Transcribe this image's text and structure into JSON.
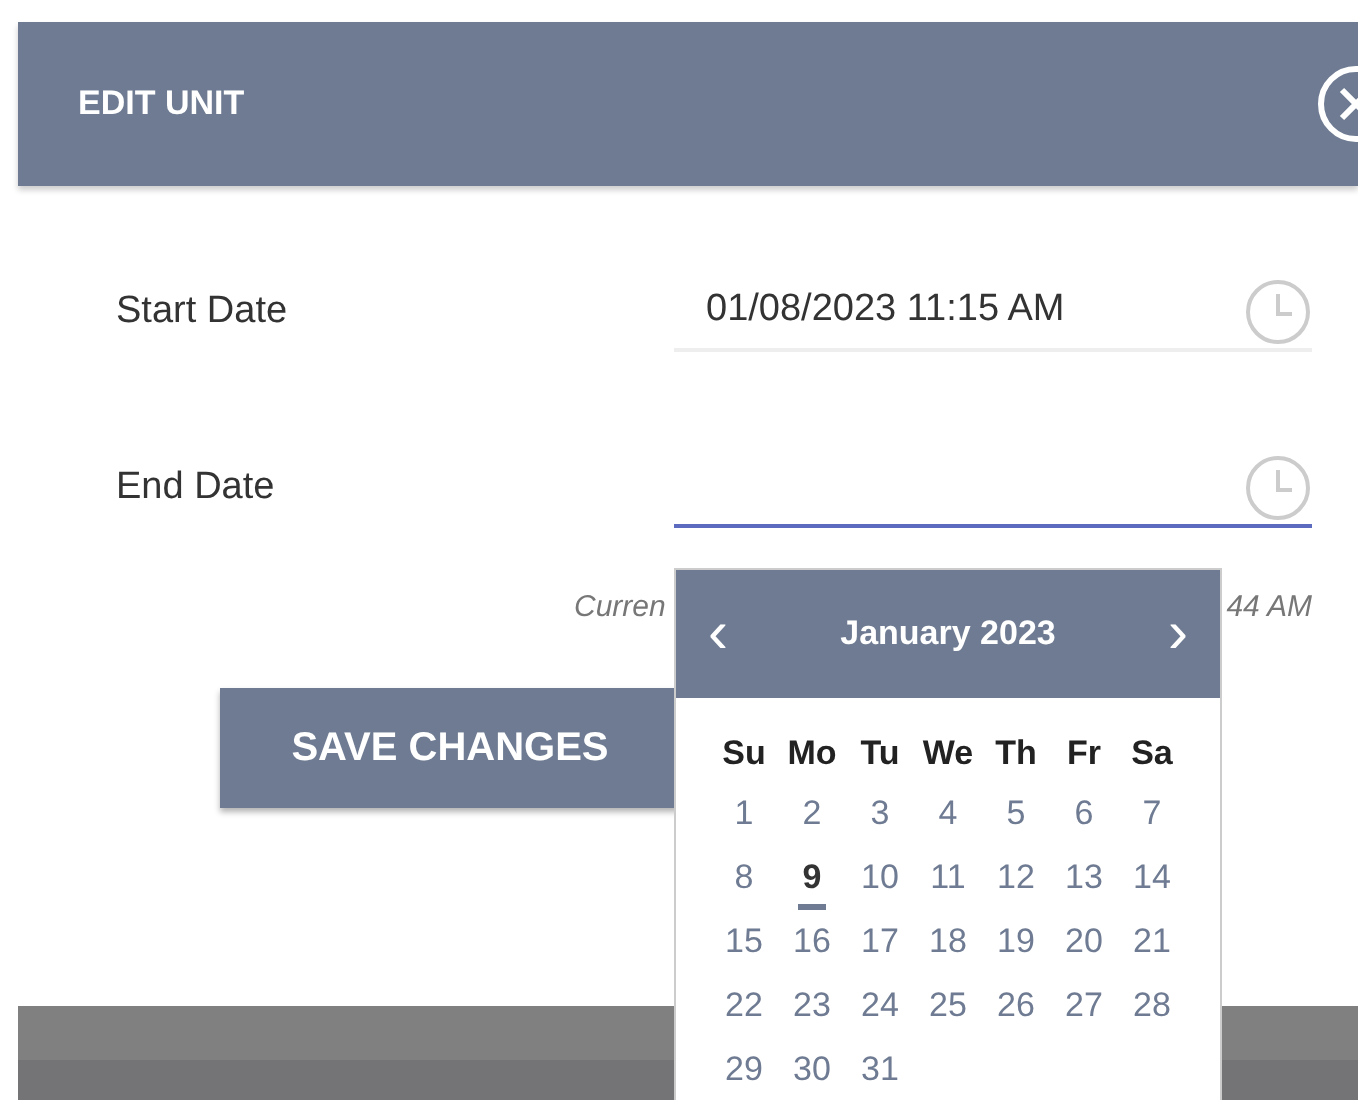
{
  "dialog": {
    "title": "EDIT UNIT"
  },
  "fields": [
    {
      "label": "Start Date",
      "value": "01/08/2023 11:15 AM",
      "focused": false
    },
    {
      "label": "End Date",
      "focused": true
    }
  ],
  "helper_text": {
    "left_part": "Curren",
    "right_part": "44 AM"
  },
  "save_button": "SAVE CHANGES",
  "calendar": {
    "month": "January 2023",
    "prev": "‹",
    "next": "›",
    "weekdays": [
      "Su",
      "Mo",
      "Tu",
      "We",
      "Th",
      "Fr",
      "Sa"
    ],
    "weeks": [
      [
        {
          "day": "1",
          "today": false
        },
        {
          "day": "2",
          "today": false
        },
        {
          "day": "3",
          "today": false
        },
        {
          "day": "4",
          "today": false
        },
        {
          "day": "5",
          "today": false
        },
        {
          "day": "6",
          "today": false
        },
        {
          "day": "7",
          "today": false
        }
      ],
      [
        {
          "day": "8",
          "today": false
        },
        {
          "day": "9",
          "today": true
        },
        {
          "day": "10",
          "today": false
        },
        {
          "day": "11",
          "today": false
        },
        {
          "day": "12",
          "today": false
        },
        {
          "day": "13",
          "today": false
        },
        {
          "day": "14",
          "today": false
        }
      ],
      [
        {
          "day": "15",
          "today": false
        },
        {
          "day": "16",
          "today": false
        },
        {
          "day": "17",
          "today": false
        },
        {
          "day": "18",
          "today": false
        },
        {
          "day": "19",
          "today": false
        },
        {
          "day": "20",
          "today": false
        },
        {
          "day": "21",
          "today": false
        }
      ],
      [
        {
          "day": "22",
          "today": false
        },
        {
          "day": "23",
          "today": false
        },
        {
          "day": "24",
          "today": false
        },
        {
          "day": "25",
          "today": false
        },
        {
          "day": "26",
          "today": false
        },
        {
          "day": "27",
          "today": false
        },
        {
          "day": "28",
          "today": false
        }
      ],
      [
        {
          "day": "29",
          "today": false
        },
        {
          "day": "30",
          "today": false
        },
        {
          "day": "31",
          "today": false
        }
      ]
    ]
  }
}
